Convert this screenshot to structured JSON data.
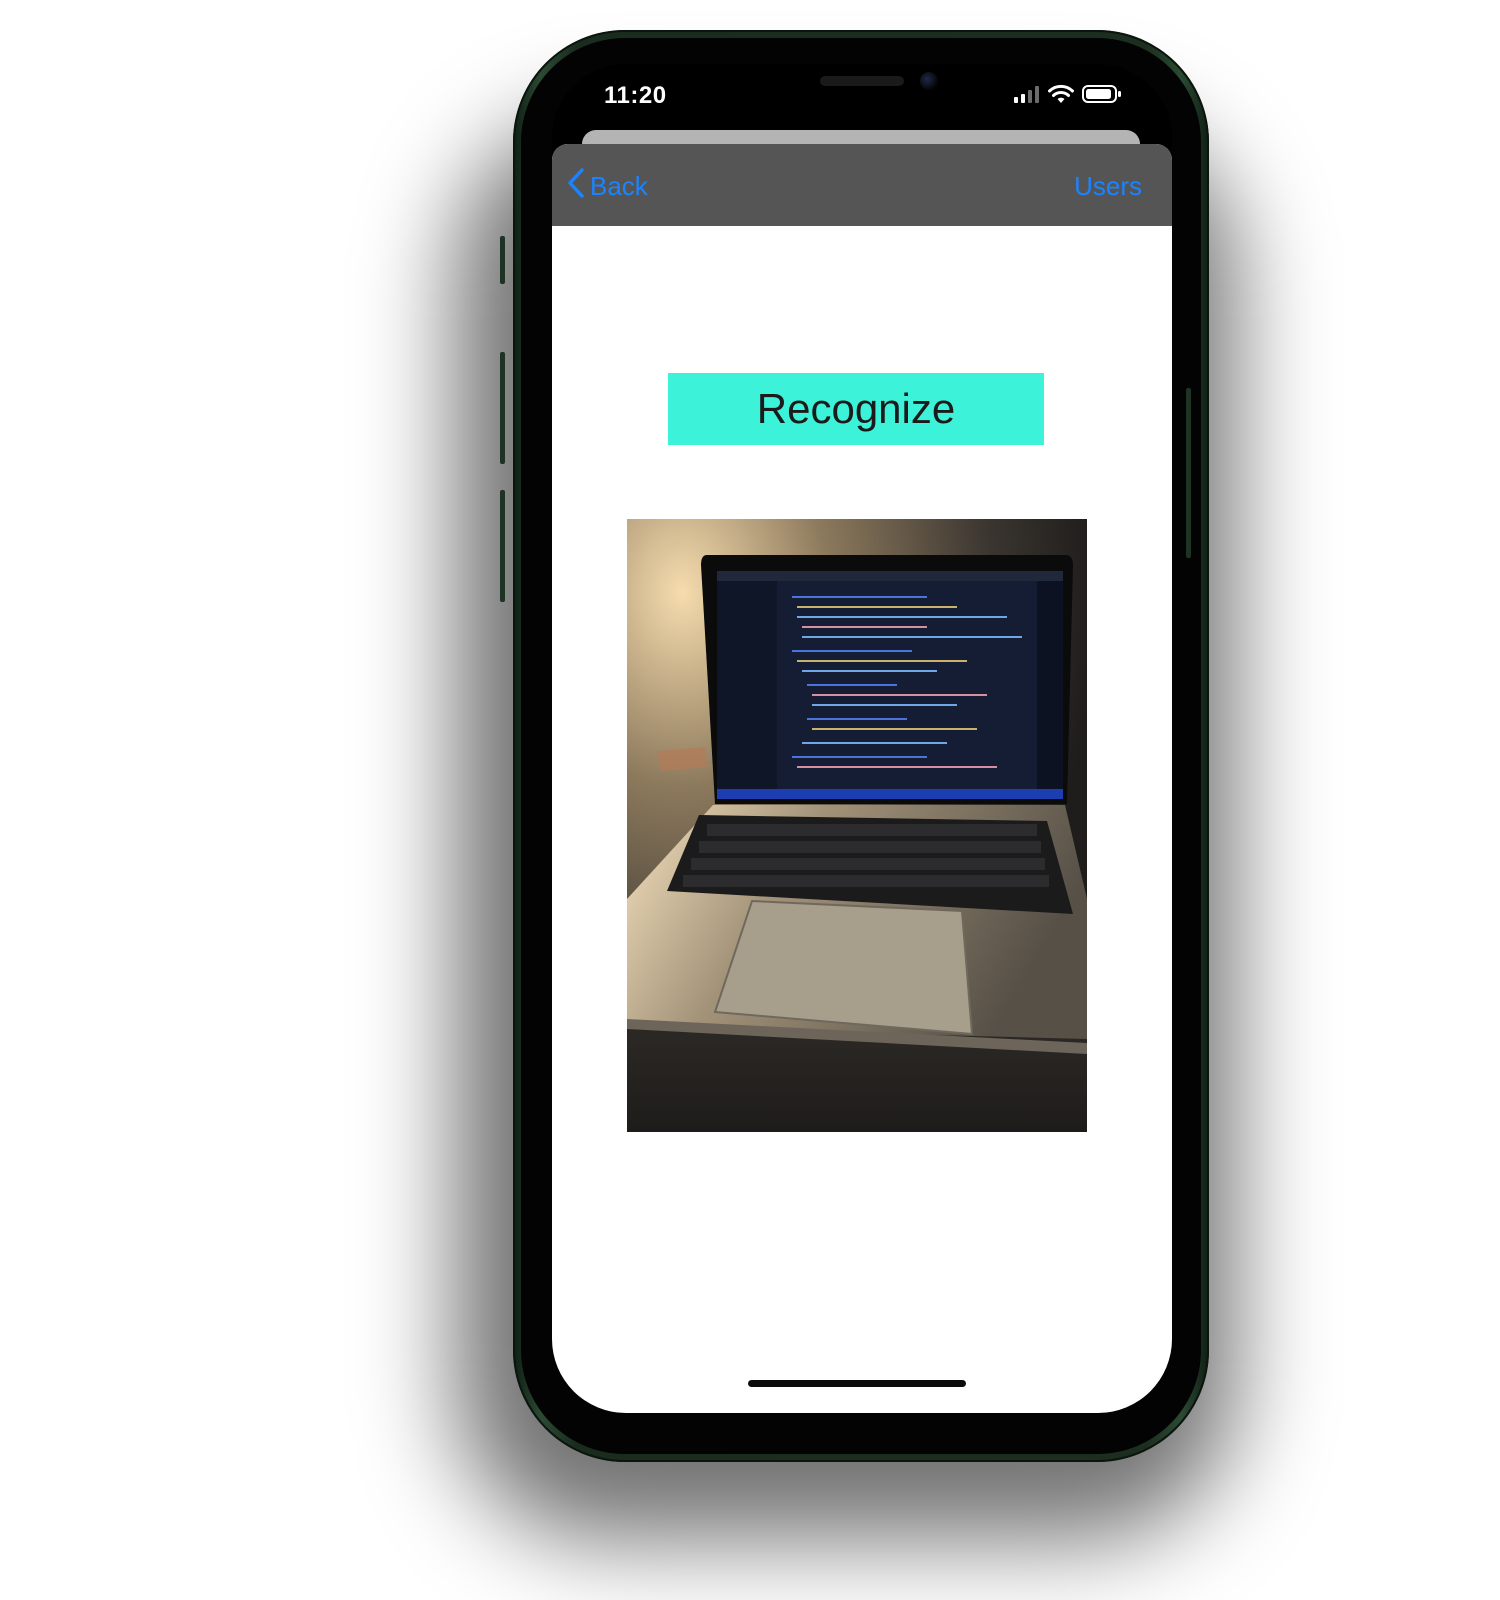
{
  "status_bar": {
    "time": "11:20",
    "icons": [
      "cellular-signal-icon",
      "wifi-icon",
      "battery-icon"
    ]
  },
  "navbar": {
    "back_label": "Back",
    "right_label": "Users"
  },
  "main": {
    "recognize_label": "Recognize",
    "photo_icon": "laptop-photo"
  },
  "colors": {
    "nav_background": "#555555",
    "link": "#1a84ff",
    "recognize_button": "#3cf2d9",
    "phone_frame": "#1c2e20"
  }
}
